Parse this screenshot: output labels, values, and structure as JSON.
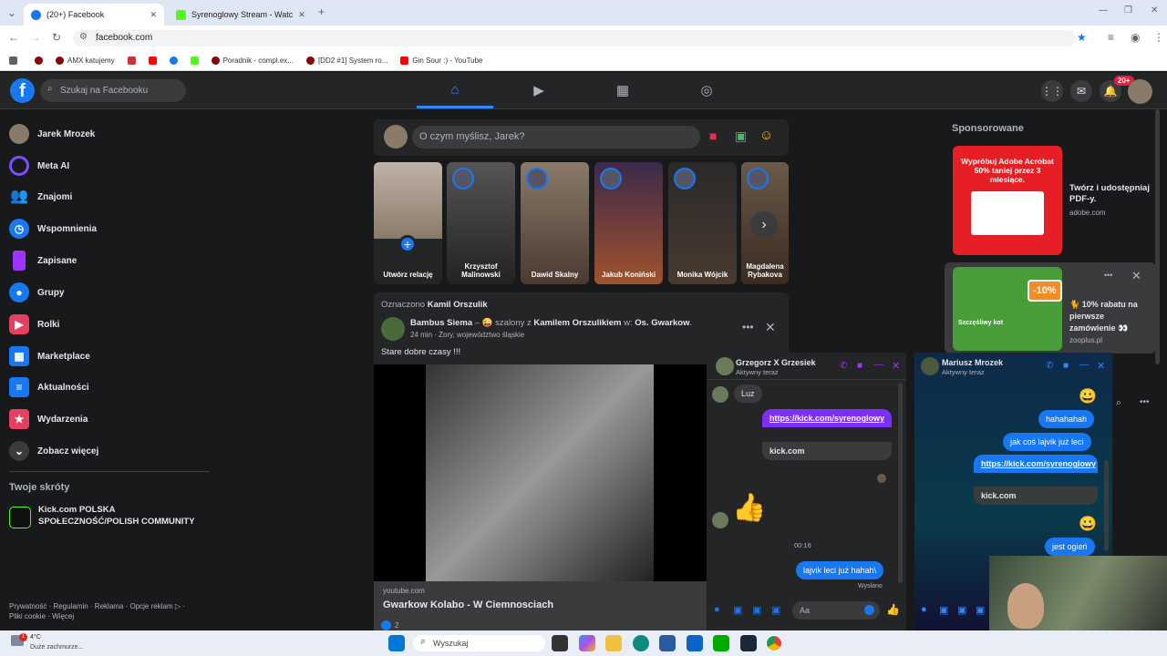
{
  "browser": {
    "tabs": [
      {
        "title": "(20+) Facebook",
        "active": true
      },
      {
        "title": "Syrenoglowy Stream - Watc"
      }
    ],
    "url": "facebook.com",
    "bookmarks": [
      "AMX katujemy",
      "Poradnik - compl.ex...",
      "[DD2 #1] System ro...",
      "Gin Sour :) - YouTube"
    ]
  },
  "header": {
    "search_placeholder": "Szukaj na Facebooku",
    "notif_badge": "20+"
  },
  "sidebar": {
    "items": [
      {
        "label": "Jarek Mrozek",
        "icon": "avatar"
      },
      {
        "label": "Meta AI",
        "icon": "meta-ai-icon",
        "color": "#7b4dff"
      },
      {
        "label": "Znajomi",
        "icon": "friends-icon",
        "color": "#1877f2"
      },
      {
        "label": "Wspomnienia",
        "icon": "memories-icon",
        "color": "#1877f2"
      },
      {
        "label": "Zapisane",
        "icon": "saved-icon",
        "color": "#a033ff"
      },
      {
        "label": "Grupy",
        "icon": "groups-icon",
        "color": "#1877f2"
      },
      {
        "label": "Rolki",
        "icon": "reels-icon",
        "color": "#e4405f"
      },
      {
        "label": "Marketplace",
        "icon": "marketplace-icon",
        "color": "#1877f2"
      },
      {
        "label": "Aktualności",
        "icon": "feeds-icon",
        "color": "#1877f2"
      },
      {
        "label": "Wydarzenia",
        "icon": "events-icon",
        "color": "#e4405f"
      },
      {
        "label": "Zobacz więcej",
        "icon": "chevron-down-icon",
        "color": "#3a3b3c"
      }
    ],
    "shortcuts_title": "Twoje skróty",
    "shortcut_line1": "Kick.com POLSKA",
    "shortcut_line2": "SPOŁECZNOŚĆ/POLISH COMMUNITY",
    "footer1": "Prywatność · Regulamin · Reklama · Opcje reklam ▷ ·",
    "footer2": "Pliki cookie · Więcej"
  },
  "composer": {
    "placeholder": "O czym myślisz, Jarek?"
  },
  "stories": [
    {
      "name": "Utwórz relację",
      "create": true
    },
    {
      "name": "Krzysztof Malinowski"
    },
    {
      "name": "Dawid Skalny"
    },
    {
      "name": "Jakub Koniński"
    },
    {
      "name": "Monika Wójcik"
    },
    {
      "name": "Magdalena Rybakova"
    }
  ],
  "post": {
    "tagged_prefix": "Oznaczono",
    "tagged_name": "Kamil Orszulik",
    "author": "Bambus Siema",
    "feeling": "szalony z",
    "with_name": "Kamilem Orszulikiem",
    "location_prefix": "w:",
    "location": "Os. Gwarkow",
    "meta": "24 min · Żory, województwo śląskie",
    "text": "Stare dobre czasy !!!",
    "link_domain": "youtube.com",
    "link_title": "Gwarkow Kolabo - W Ciemnosciach",
    "reactions": "2"
  },
  "sponsored": {
    "title": "Sponsorowane",
    "ads": [
      {
        "image_text": "Wypróbuj Adobe Acrobat 50% taniej przez 3 miesiące.",
        "title": "Twórz i udostępniaj PDF-y.",
        "domain": "adobe.com"
      },
      {
        "badge": "-10%",
        "image_caption": "Szczęśliwy kot",
        "title": "🐈 10% rabatu na pierwsze zamówienie 👀",
        "domain": "zooplus.pl"
      }
    ]
  },
  "chat1": {
    "name": "Grzegorz X Grzesiek",
    "status": "Aktywny teraz",
    "msg_in": "Luz",
    "link": "https://kick.com/syrenoglowy",
    "link_domain": "kick.com",
    "time": "00:16",
    "msg_out": "lajvik leci już hahah\\",
    "sent": "Wysłano",
    "input_placeholder": "Aa"
  },
  "chat2": {
    "name": "Mariusz Mrozek",
    "status": "Aktywny teraz",
    "msg1": "hahahahah",
    "msg2": "jak coś lajvik już leci",
    "link": "https://kick.com/syrenoglowy",
    "link_domain": "kick.com",
    "msg3": "jest ogień"
  },
  "taskbar": {
    "weather_temp": "4°C",
    "weather_desc": "Duże zachmurze...",
    "search_placeholder": "Wyszukaj"
  }
}
